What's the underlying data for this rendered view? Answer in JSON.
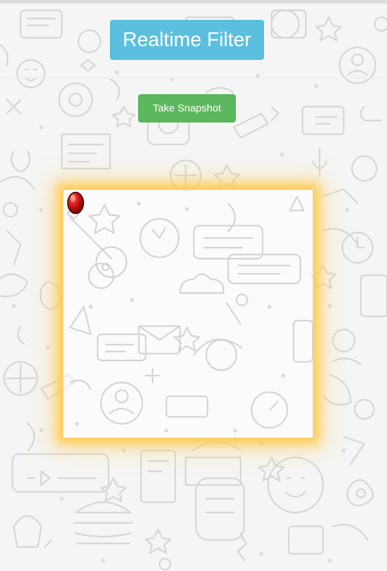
{
  "header": {
    "title": "Realtime Filter"
  },
  "toolbar": {
    "snapshot_label": "Take Snapshot"
  },
  "colors": {
    "title_bg": "#5bc0de",
    "snapshot_bg": "#5cb85c",
    "glow": "#ffc846",
    "ball": "#d81818"
  },
  "icons": {
    "ball": "red-ball-icon",
    "background": "doodle-pattern"
  }
}
